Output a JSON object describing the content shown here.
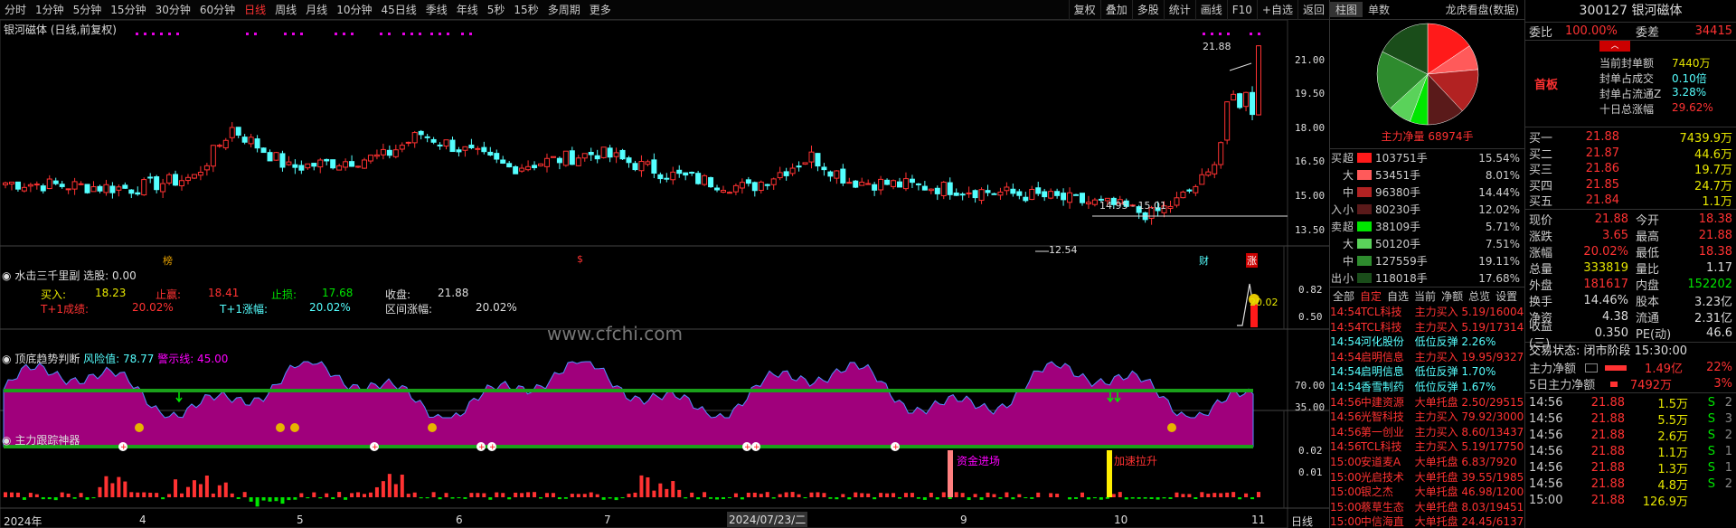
{
  "toolbar": {
    "periods": [
      "分时",
      "1分钟",
      "5分钟",
      "15分钟",
      "30分钟",
      "60分钟",
      "日线",
      "周线",
      "月线",
      "10分钟",
      "45日线",
      "季线",
      "年线",
      "5秒",
      "15秒",
      "多周期",
      "更多"
    ],
    "active_period": "日线",
    "right_tools": [
      "复权",
      "叠加",
      "多股",
      "统计",
      "画线",
      "F10",
      "+自选",
      "返回"
    ]
  },
  "main_chart": {
    "title": "银河磁体 (日线,前复权)",
    "y_ticks": [
      "21.00",
      "19.50",
      "18.00",
      "16.50",
      "15.00",
      "13.50"
    ],
    "high_label": "21.88",
    "range_label": "14.95 - 15.01",
    "low_label": "12.54",
    "markers": [
      "榜",
      "$",
      "财",
      "涨"
    ]
  },
  "panel2": {
    "title": "水击三千里副",
    "select_label": "选股: 0.00",
    "buy_label": "买入:",
    "buy_value": "18.23",
    "profit_label": "止赢:",
    "profit_value": "18.41",
    "stop_label": "止损:",
    "stop_value": "17.68",
    "close_label": "收盘:",
    "close_value": "21.88",
    "t1_label": "T+1成绩:",
    "t1_value": "20.02%",
    "t1_rise_label": "T+1涨幅:",
    "t1_rise_value": "20.02%",
    "range_rise_label": "区间涨幅:",
    "range_rise_value": "20.02%",
    "watermark": "www.cfchi.com",
    "y_ticks": [
      "0.82",
      "0.50"
    ],
    "peak_label": "20.02"
  },
  "panel3": {
    "title": "顶底趋势判断",
    "risk_label": "风险值: 78.77",
    "warn_label": "警示线: 45.00",
    "y_ticks": [
      "70.00",
      "35.00"
    ]
  },
  "panel4": {
    "title": "主力跟踪神器",
    "y_ticks": [
      "0.02",
      "0.01"
    ],
    "ann1": "资金进场",
    "ann2": "加速拉升"
  },
  "x_axis": {
    "labels": [
      "2024年",
      "4",
      "5",
      "6",
      "7",
      "2024/07/23/二",
      "9",
      "10",
      "11"
    ],
    "period_tag": "日线"
  },
  "side1": {
    "tabs": [
      "柱图",
      "单数",
      "龙虎看盘(数据)"
    ],
    "net_label": "主力净量 68974手",
    "buy_side": "买",
    "sell_side": "卖",
    "in_label": "入",
    "out_label": "出",
    "buy_rows": [
      {
        "lvl": "超",
        "amt": "103751手",
        "pct": "15.54%",
        "color": "#ff1a1a"
      },
      {
        "lvl": "大",
        "amt": "53451手",
        "pct": "8.01%",
        "color": "#ff5a5a"
      },
      {
        "lvl": "中",
        "amt": "96380手",
        "pct": "14.44%",
        "color": "#b22222"
      },
      {
        "lvl": "小",
        "amt": "80230手",
        "pct": "12.02%",
        "color": "#5a1a1a"
      }
    ],
    "sell_rows": [
      {
        "lvl": "超",
        "amt": "38109手",
        "pct": "5.71%",
        "color": "#00e600"
      },
      {
        "lvl": "大",
        "amt": "50120手",
        "pct": "7.51%",
        "color": "#5ad25a"
      },
      {
        "lvl": "中",
        "amt": "127559手",
        "pct": "19.11%",
        "color": "#2e8b2e"
      },
      {
        "lvl": "小",
        "amt": "118018手",
        "pct": "17.68%",
        "color": "#1a4d1a"
      }
    ],
    "deal_tabs": [
      "全部",
      "自定",
      "自选",
      "当前",
      "净额",
      "总览",
      "设置"
    ],
    "deals": [
      {
        "t": "14:54",
        "name": "TCL科技",
        "type": "主力买入",
        "val": "5.19/16004",
        "c": "red"
      },
      {
        "t": "14:54",
        "name": "TCL科技",
        "type": "主力买入",
        "val": "5.19/17314",
        "c": "red"
      },
      {
        "t": "14:54",
        "name": "河化股份",
        "type": "低位反弹",
        "val": "2.26%",
        "c": "cyan"
      },
      {
        "t": "14:54",
        "name": "启明信息",
        "type": "主力买入",
        "val": "19.95/9327",
        "c": "red"
      },
      {
        "t": "14:54",
        "name": "启明信息",
        "type": "低位反弹",
        "val": "1.70%",
        "c": "cyan"
      },
      {
        "t": "14:54",
        "name": "香雪制药",
        "type": "低位反弹",
        "val": "1.67%",
        "c": "cyan"
      },
      {
        "t": "14:56",
        "name": "中建资源",
        "type": "大单托盘",
        "val": "2.50/29515",
        "c": "red"
      },
      {
        "t": "14:56",
        "name": "光智科技",
        "type": "主力买入",
        "val": "79.92/3000",
        "c": "red"
      },
      {
        "t": "14:56",
        "name": "第一创业",
        "type": "主力买入",
        "val": "8.60/13437",
        "c": "red"
      },
      {
        "t": "14:56",
        "name": "TCL科技",
        "type": "主力买入",
        "val": "5.19/17750",
        "c": "red"
      },
      {
        "t": "15:00",
        "name": "安道麦A",
        "type": "大单托盘",
        "val": "6.83/7920",
        "c": "red"
      },
      {
        "t": "15:00",
        "name": "光启技术",
        "type": "大单托盘",
        "val": "39.55/1985",
        "c": "red"
      },
      {
        "t": "15:00",
        "name": "银之杰",
        "type": "大单托盘",
        "val": "46.98/12003",
        "c": "red"
      },
      {
        "t": "15:00",
        "name": "蔡草生态",
        "type": "大单托盘",
        "val": "8.03/19451",
        "c": "red"
      },
      {
        "t": "15:00",
        "name": "中信海直",
        "type": "大单托盘",
        "val": "24.45/6137",
        "c": "red"
      }
    ]
  },
  "side2": {
    "code_name": "300127 银河磁体",
    "weibi_label": "委比",
    "weibi_value": "100.00%",
    "weicha_label": "委差",
    "weicha_value": "34415",
    "board_label": "首板",
    "seal_rows": [
      {
        "k": "当前封单额",
        "v": "7440万",
        "c": "yellow"
      },
      {
        "k": "封单占成交",
        "v": "0.10倍",
        "c": "cyan"
      },
      {
        "k": "封单占流通Z",
        "v": "3.28%",
        "c": "cyan"
      },
      {
        "k": "十日总涨幅",
        "v": "29.62%",
        "c": "red"
      }
    ],
    "buys": [
      {
        "lab": "买一",
        "price": "21.88",
        "vol": "7439.9万"
      },
      {
        "lab": "买二",
        "price": "21.87",
        "vol": "44.6万"
      },
      {
        "lab": "买三",
        "price": "21.86",
        "vol": "19.7万"
      },
      {
        "lab": "买四",
        "price": "21.85",
        "vol": "24.7万"
      },
      {
        "lab": "买五",
        "price": "21.84",
        "vol": "1.1万"
      }
    ],
    "stats": [
      {
        "k1": "现价",
        "v1": "21.88",
        "c1": "red",
        "k2": "今开",
        "v2": "18.38",
        "c2": "red"
      },
      {
        "k1": "涨跌",
        "v1": "3.65",
        "c1": "red",
        "k2": "最高",
        "v2": "21.88",
        "c2": "red"
      },
      {
        "k1": "涨幅",
        "v1": "20.02%",
        "c1": "red",
        "k2": "最低",
        "v2": "18.38",
        "c2": "red"
      },
      {
        "k1": "总量",
        "v1": "333819",
        "c1": "yellow",
        "k2": "量比",
        "v2": "1.17",
        "c2": "white"
      },
      {
        "k1": "外盘",
        "v1": "181617",
        "c1": "red",
        "k2": "内盘",
        "v2": "152202",
        "c2": "green"
      },
      {
        "k1": "换手",
        "v1": "14.46%",
        "c1": "white",
        "k2": "股本",
        "v2": "3.23亿",
        "c2": "white"
      },
      {
        "k1": "净资",
        "v1": "4.38",
        "c1": "white",
        "k2": "流通",
        "v2": "2.31亿",
        "c2": "white"
      },
      {
        "k1": "收益(三)",
        "v1": "0.350",
        "c1": "white",
        "k2": "PE(动)",
        "v2": "46.6",
        "c2": "white"
      }
    ],
    "trade_status": "交易状态: 闭市阶段 15:30:00",
    "main_net_label": "主力净额",
    "main_net_value": "1.49亿",
    "main_net_pct": "22%",
    "five_day_label": "5日主力净额",
    "five_day_value": "7492万",
    "five_day_pct": "3%",
    "ticks": [
      {
        "tm": "14:56",
        "tp": "21.88",
        "tv": "1.5万",
        "td": "S",
        "tc": "2"
      },
      {
        "tm": "14:56",
        "tp": "21.88",
        "tv": "5.5万",
        "td": "S",
        "tc": "3"
      },
      {
        "tm": "14:56",
        "tp": "21.88",
        "tv": "2.6万",
        "td": "S",
        "tc": "2"
      },
      {
        "tm": "14:56",
        "tp": "21.88",
        "tv": "1.1万",
        "td": "S",
        "tc": "1"
      },
      {
        "tm": "14:56",
        "tp": "21.88",
        "tv": "1.3万",
        "td": "S",
        "tc": "1"
      },
      {
        "tm": "14:56",
        "tp": "21.88",
        "tv": "4.8万",
        "td": "S",
        "tc": "2"
      },
      {
        "tm": "15:00",
        "tp": "21.88",
        "tv": "126.9万",
        "td": "",
        "tc": ""
      }
    ]
  },
  "colors": {
    "up": "#ff3232",
    "down": "#54ffff",
    "magenta": "#b4008c",
    "accent": "#ff3232"
  }
}
